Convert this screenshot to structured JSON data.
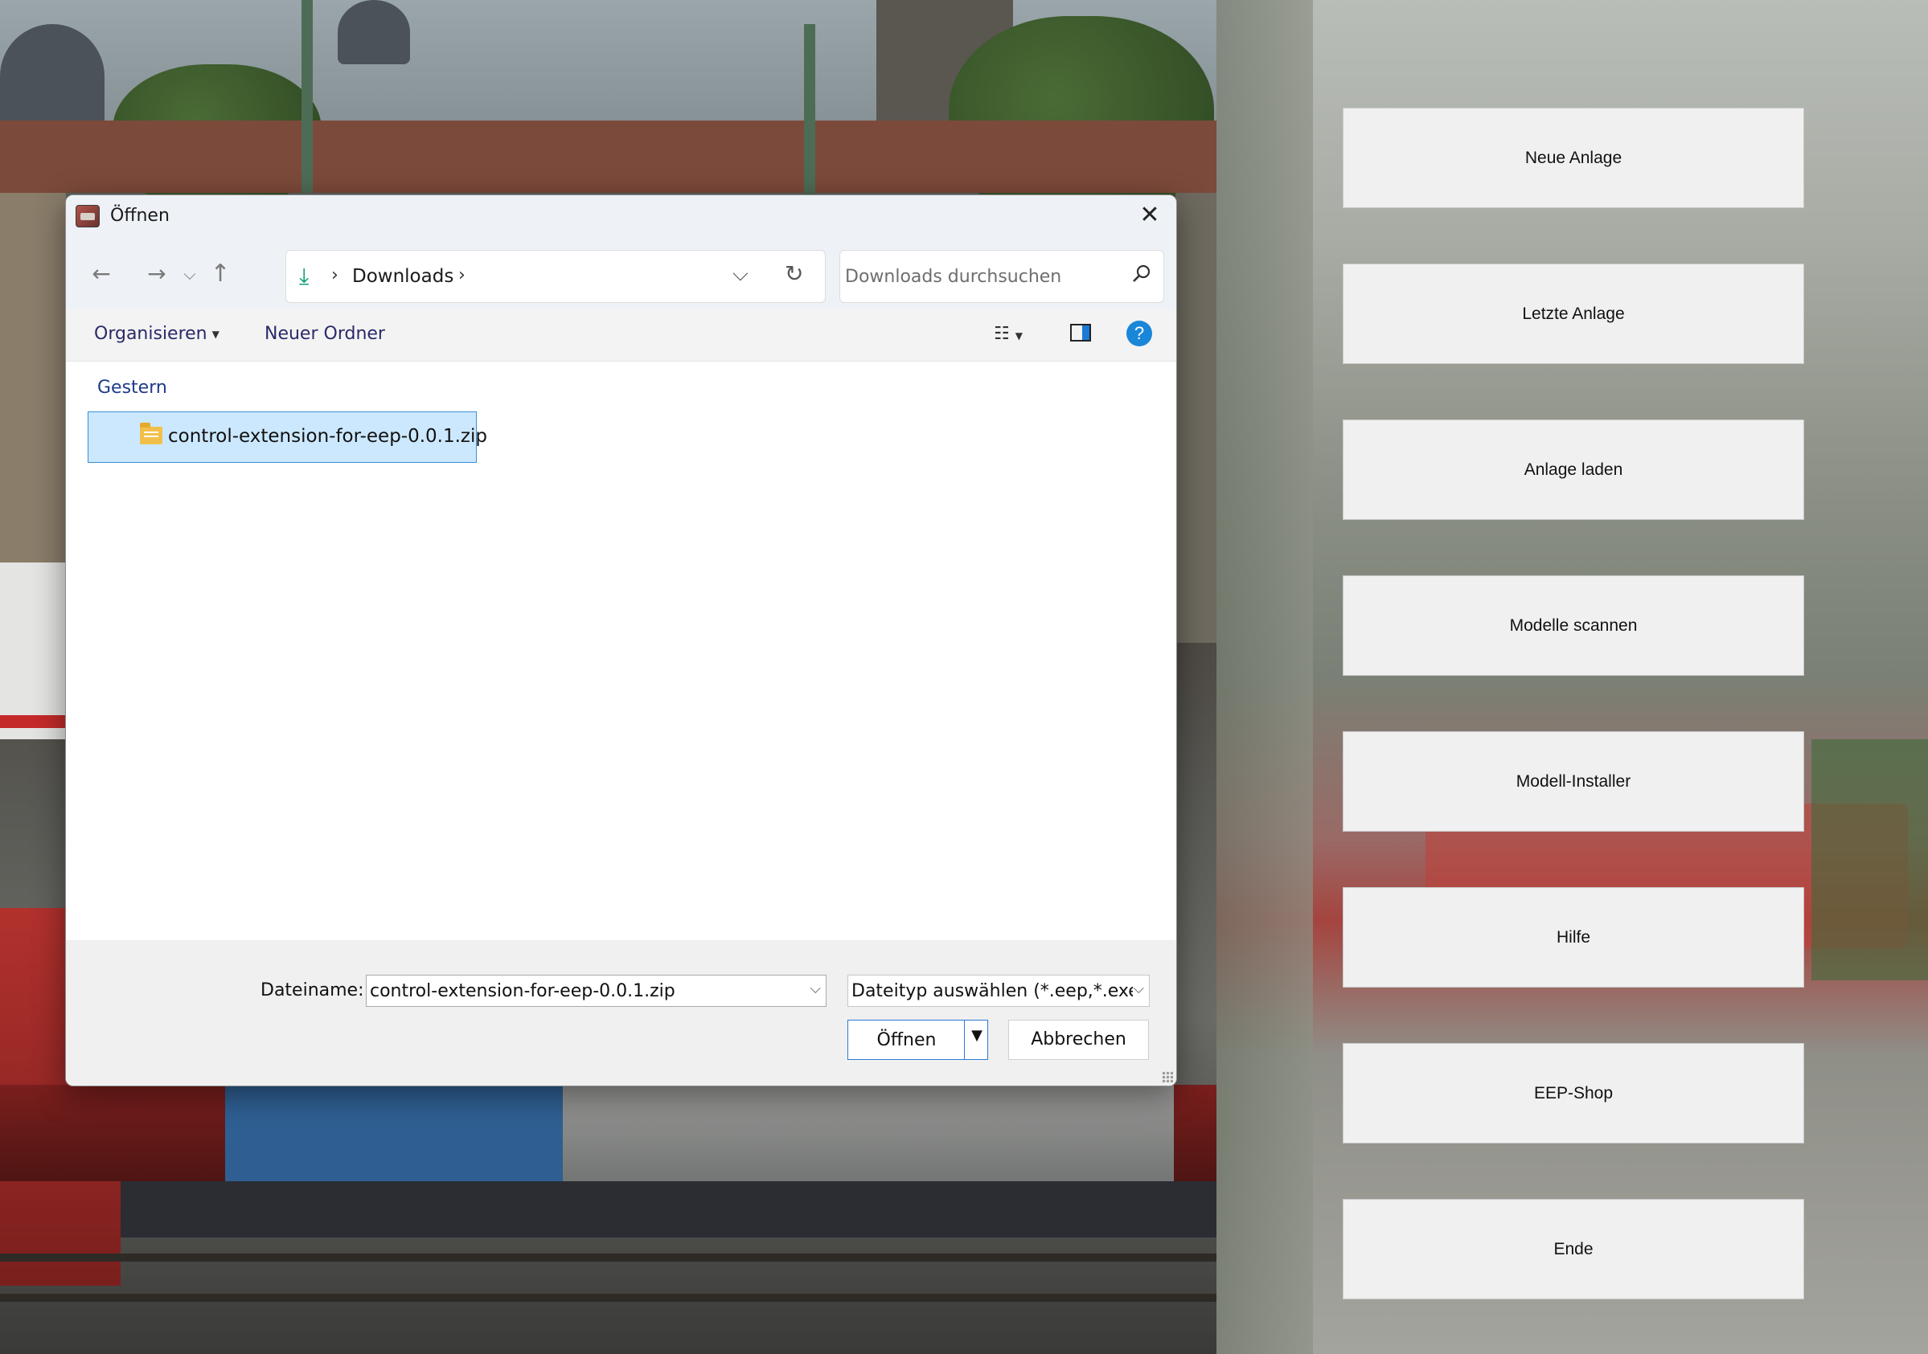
{
  "menu": {
    "buttons": [
      {
        "label": "Neue Anlage"
      },
      {
        "label": "Letzte Anlage"
      },
      {
        "label": "Anlage laden"
      },
      {
        "label": "Modelle scannen"
      },
      {
        "label": "Modell-Installer"
      },
      {
        "label": "Hilfe"
      },
      {
        "label": "EEP-Shop"
      },
      {
        "label": "Ende"
      }
    ]
  },
  "dialog": {
    "title": "Öffnen",
    "nav": {
      "back_icon": "arrow-left-icon",
      "forward_icon": "arrow-right-icon",
      "recent_icon": "chevron-down-icon",
      "up_icon": "arrow-up-icon"
    },
    "address": {
      "crumb": "Downloads",
      "icon": "download-icon"
    },
    "search": {
      "placeholder": "Downloads durchsuchen"
    },
    "commands": {
      "organize": "Organisieren",
      "new_folder": "Neuer Ordner"
    },
    "group_header": "Gestern",
    "files": [
      {
        "name": "control-extension-for-eep-0.0.1.zip",
        "selected": true,
        "icon": "zip-folder-icon"
      }
    ],
    "footer": {
      "filename_label": "Dateiname:",
      "filename_value": "control-extension-for-eep-0.0.1.zip",
      "filetype_value": "Dateityp auswählen (*.eep,*.exe",
      "open_label": "Öffnen",
      "cancel_label": "Abbrechen"
    }
  },
  "colors": {
    "accent": "#1a86d8",
    "selection": "#cce8ff",
    "menu_button_bg": "#f0f0f0"
  }
}
